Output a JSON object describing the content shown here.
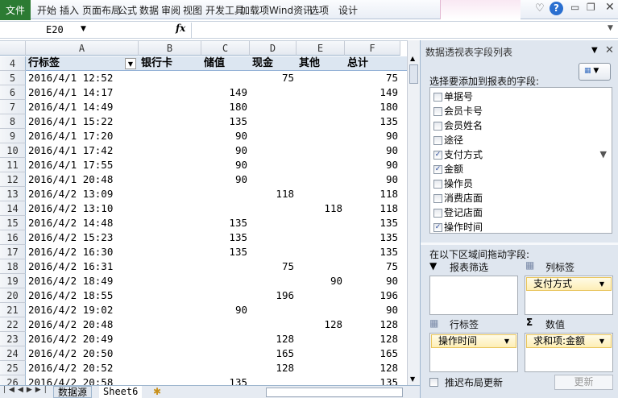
{
  "ribbon": {
    "file": "文件",
    "tabs": [
      "开始",
      "插入",
      "页面布局",
      "公式",
      "数据",
      "审阅",
      "视图",
      "开发工具",
      "加载项",
      "Wind资讯"
    ],
    "context_tabs": [
      "选项",
      "设计"
    ]
  },
  "formula_bar": {
    "name_box": "E20",
    "fx": "fx",
    "value": ""
  },
  "columns": [
    "A",
    "B",
    "C",
    "D",
    "E",
    "F"
  ],
  "pivot": {
    "header_row": 4,
    "headers": [
      "行标签",
      "银行卡",
      "储值",
      "现金",
      "其他",
      "总计"
    ],
    "rows": [
      {
        "row": 5,
        "label": "2016/4/1 12:52",
        "values": [
          "",
          "",
          "75",
          "",
          "75"
        ]
      },
      {
        "row": 6,
        "label": "2016/4/1 14:17",
        "values": [
          "",
          "149",
          "",
          "",
          "149"
        ]
      },
      {
        "row": 7,
        "label": "2016/4/1 14:49",
        "values": [
          "",
          "180",
          "",
          "",
          "180"
        ]
      },
      {
        "row": 8,
        "label": "2016/4/1 15:22",
        "values": [
          "",
          "135",
          "",
          "",
          "135"
        ]
      },
      {
        "row": 9,
        "label": "2016/4/1 17:20",
        "values": [
          "",
          "90",
          "",
          "",
          "90"
        ]
      },
      {
        "row": 10,
        "label": "2016/4/1 17:42",
        "values": [
          "",
          "90",
          "",
          "",
          "90"
        ]
      },
      {
        "row": 11,
        "label": "2016/4/1 17:55",
        "values": [
          "",
          "90",
          "",
          "",
          "90"
        ]
      },
      {
        "row": 12,
        "label": "2016/4/1 20:48",
        "values": [
          "",
          "90",
          "",
          "",
          "90"
        ]
      },
      {
        "row": 13,
        "label": "2016/4/2 13:09",
        "values": [
          "",
          "",
          "118",
          "",
          "118"
        ]
      },
      {
        "row": 14,
        "label": "2016/4/2 13:10",
        "values": [
          "",
          "",
          "",
          "118",
          "118"
        ]
      },
      {
        "row": 15,
        "label": "2016/4/2 14:48",
        "values": [
          "",
          "135",
          "",
          "",
          "135"
        ]
      },
      {
        "row": 16,
        "label": "2016/4/2 15:23",
        "values": [
          "",
          "135",
          "",
          "",
          "135"
        ]
      },
      {
        "row": 17,
        "label": "2016/4/2 16:30",
        "values": [
          "",
          "135",
          "",
          "",
          "135"
        ]
      },
      {
        "row": 18,
        "label": "2016/4/2 16:31",
        "values": [
          "",
          "",
          "75",
          "",
          "75"
        ]
      },
      {
        "row": 19,
        "label": "2016/4/2 18:49",
        "values": [
          "",
          "",
          "",
          "90",
          "90"
        ]
      },
      {
        "row": 20,
        "label": "2016/4/2 18:55",
        "values": [
          "",
          "",
          "196",
          "",
          "196"
        ]
      },
      {
        "row": 21,
        "label": "2016/4/2 19:02",
        "values": [
          "",
          "90",
          "",
          "",
          "90"
        ]
      },
      {
        "row": 22,
        "label": "2016/4/2 20:48",
        "values": [
          "",
          "",
          "",
          "128",
          "128"
        ]
      },
      {
        "row": 23,
        "label": "2016/4/2 20:49",
        "values": [
          "",
          "",
          "128",
          "",
          "128"
        ]
      },
      {
        "row": 24,
        "label": "2016/4/2 20:50",
        "values": [
          "",
          "",
          "165",
          "",
          "165"
        ]
      },
      {
        "row": 25,
        "label": "2016/4/2 20:52",
        "values": [
          "",
          "",
          "128",
          "",
          "128"
        ]
      },
      {
        "row": 26,
        "label": "2016/4/2 20:58",
        "values": [
          "",
          "135",
          "",
          "",
          "135"
        ]
      }
    ]
  },
  "sheet_tabs": [
    "数据源",
    "Sheet6"
  ],
  "active_sheet": "Sheet6",
  "field_list": {
    "title": "数据透视表字段列表",
    "choose_label": "选择要添加到报表的字段:",
    "fields": [
      {
        "name": "单据号",
        "checked": false
      },
      {
        "name": "会员卡号",
        "checked": false
      },
      {
        "name": "会员姓名",
        "checked": false
      },
      {
        "name": "途径",
        "checked": false
      },
      {
        "name": "支付方式",
        "checked": true,
        "filtered": true
      },
      {
        "name": "金额",
        "checked": true
      },
      {
        "name": "操作员",
        "checked": false
      },
      {
        "name": "消费店面",
        "checked": false
      },
      {
        "name": "登记店面",
        "checked": false
      },
      {
        "name": "操作时间",
        "checked": true
      }
    ],
    "drag_label": "在以下区域间拖动字段:",
    "areas": {
      "filter": {
        "label": "报表筛选",
        "items": []
      },
      "columns": {
        "label": "列标签",
        "items": [
          "支付方式"
        ]
      },
      "rows": {
        "label": "行标签",
        "items": [
          "操作时间"
        ]
      },
      "values": {
        "label": "数值",
        "items": [
          "求和项:金额"
        ]
      }
    },
    "defer_label": "推迟布局更新",
    "update_button": "更新"
  }
}
